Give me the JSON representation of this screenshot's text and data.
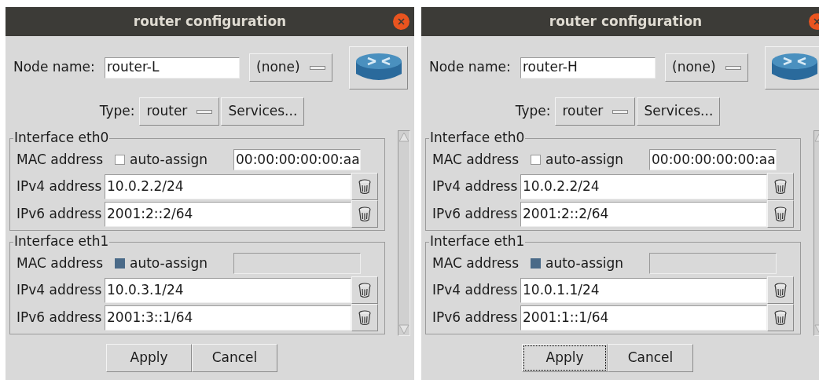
{
  "dialogs": [
    {
      "title": "router configuration",
      "node_name_label": "Node name:",
      "node_name": "router-L",
      "canvas_select": "(none)",
      "type_label": "Type:",
      "type_select": "router",
      "services_button": "Services...",
      "interfaces": [
        {
          "legend": "Interface eth0",
          "mac_label": "MAC address",
          "auto_assign_label": "auto-assign",
          "auto_assign_checked": false,
          "mac_value": "00:00:00:00:00:aa",
          "ipv4_label": "IPv4 address",
          "ipv4": "10.0.2.2/24",
          "ipv6_label": "IPv6 address",
          "ipv6": "2001:2::2/64"
        },
        {
          "legend": "Interface eth1",
          "mac_label": "MAC address",
          "auto_assign_label": "auto-assign",
          "auto_assign_checked": true,
          "ipv4_label": "IPv4 address",
          "ipv4": "10.0.3.1/24",
          "ipv6_label": "IPv6 address",
          "ipv6": "2001:3::1/64"
        }
      ],
      "buttons": [
        {
          "label": "Apply",
          "focused": false
        },
        {
          "label": "Cancel",
          "focused": false
        }
      ]
    },
    {
      "title": "router configuration",
      "node_name_label": "Node name:",
      "node_name": "router-H",
      "canvas_select": "(none)",
      "type_label": "Type:",
      "type_select": "router",
      "services_button": "Services...",
      "interfaces": [
        {
          "legend": "Interface eth0",
          "mac_label": "MAC address",
          "auto_assign_label": "auto-assign",
          "auto_assign_checked": false,
          "mac_value": "00:00:00:00:00:aa",
          "ipv4_label": "IPv4 address",
          "ipv4": "10.0.2.2/24",
          "ipv6_label": "IPv6 address",
          "ipv6": "2001:2::2/64"
        },
        {
          "legend": "Interface eth1",
          "mac_label": "MAC address",
          "auto_assign_label": "auto-assign",
          "auto_assign_checked": true,
          "ipv4_label": "IPv4 address",
          "ipv4": "10.0.1.1/24",
          "ipv6_label": "IPv6 address",
          "ipv6": "2001:1::1/64"
        }
      ],
      "buttons": [
        {
          "label": "Apply",
          "focused": true
        },
        {
          "label": "Cancel",
          "focused": false
        }
      ]
    }
  ]
}
